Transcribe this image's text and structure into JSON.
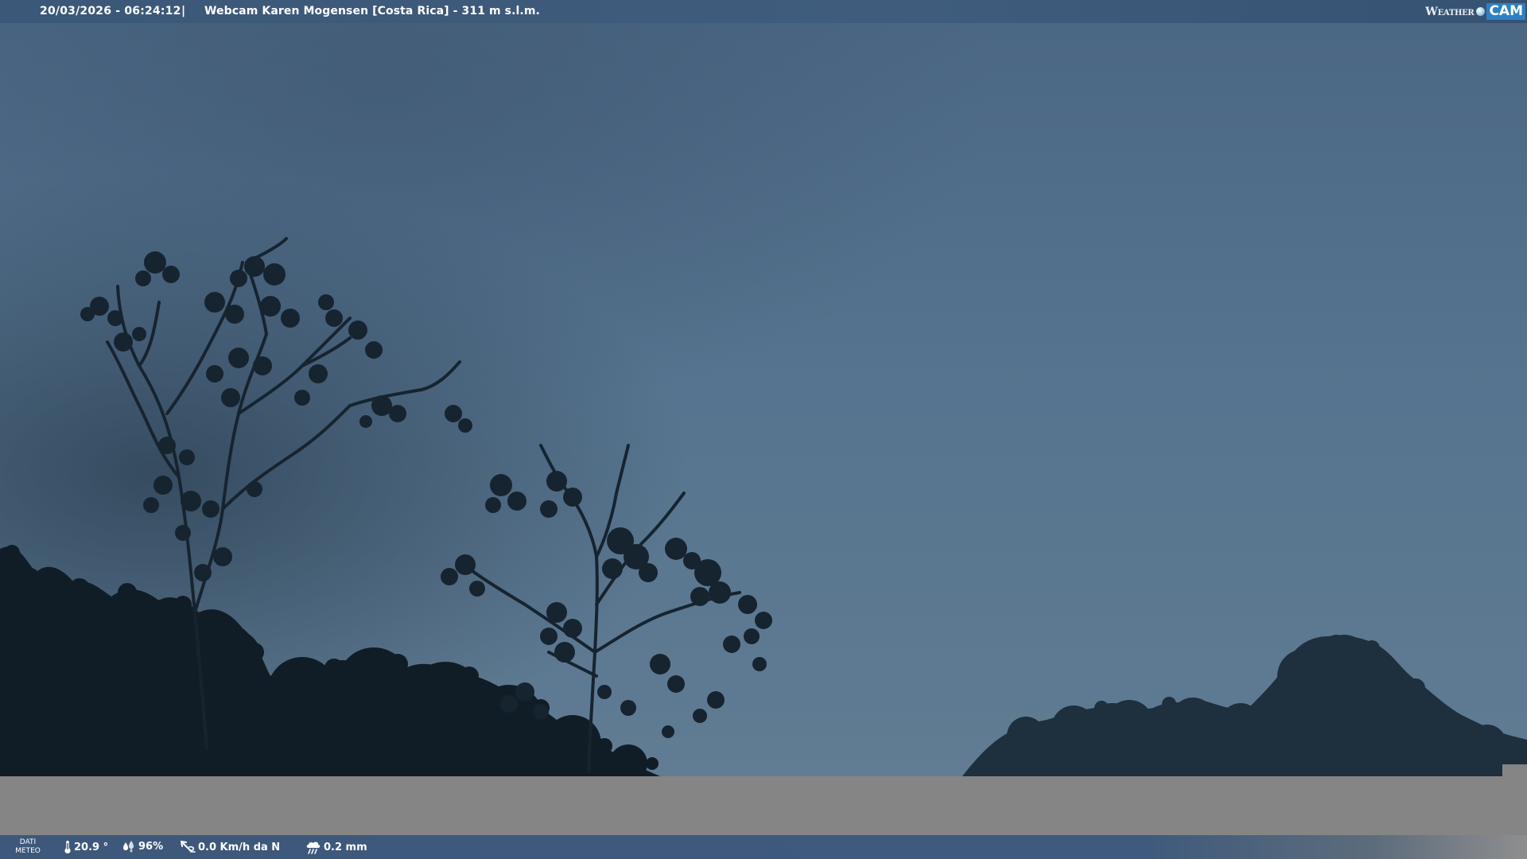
{
  "header": {
    "datetime": "20/03/2026 - 06:24:12",
    "separator": "|",
    "title": "Webcam Karen Mogensen [Costa Rica]  - 311 m s.l.m.",
    "logo_weather": "Weather",
    "logo_cam": "CAM"
  },
  "footer": {
    "meteo_label_line1": "DATI",
    "meteo_label_line2": "METEO",
    "temperature": "20.9 °",
    "humidity": "96%",
    "wind": "0.0 Km/h da N",
    "rain": "0.2 mm"
  },
  "icons": {
    "temperature": "thermometer-icon",
    "humidity": "water-drops-icon",
    "wind": "wind-icon",
    "rain": "rain-cloud-icon"
  },
  "colors": {
    "bar": "#3e5a7c",
    "sky": "#5a7a98",
    "band": "#858585",
    "logo_accent": "#2f7fc4"
  }
}
